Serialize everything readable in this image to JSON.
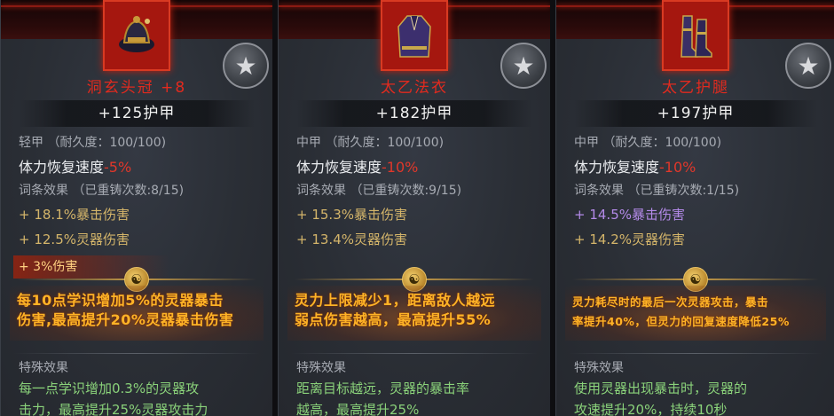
{
  "cards": [
    {
      "name": "洞玄头冠 +8",
      "armor": "+125护甲",
      "type_line": "轻甲 （耐久度：100/100)",
      "stamina_label": "体力恢复速度",
      "stamina_value": "-5%",
      "affix_header": "词条效果 （已重铸次数:8/15)",
      "stat1": "+ 18.1%暴击伤害",
      "stat2": "+ 12.5%灵器伤害",
      "stat3": "+ 3%伤害",
      "legend_line1": "每10点学识增加5%的灵器暴击",
      "legend_line2": "伤害,最高提升20%灵器暴击伤害",
      "special_title": "特殊效果",
      "special_line1": "每一点学识增加0.3%的灵器攻",
      "special_line2": "击力，最高提升25%灵器攻击力"
    },
    {
      "name": "太乙法衣",
      "armor": "+182护甲",
      "type_line": "中甲 （耐久度：100/100)",
      "stamina_label": "体力恢复速度",
      "stamina_value": "-10%",
      "affix_header": "词条效果 （已重铸次数:9/15)",
      "stat1": "+ 15.3%暴击伤害",
      "stat2": "+ 13.4%灵器伤害",
      "legend_line1": "灵力上限减少1，距离敌人越远",
      "legend_line2": "弱点伤害越高，最高提升55%",
      "special_title": "特殊效果",
      "special_line1": "距离目标越远，灵器的暴击率",
      "special_line2": "越高，最高提升25%"
    },
    {
      "name": "太乙护腿",
      "armor": "+197护甲",
      "type_line": "中甲 （耐久度：100/100)",
      "stamina_label": "体力恢复速度",
      "stamina_value": "-10%",
      "affix_header": "词条效果 （已重铸次数:1/15)",
      "stat1": "+ 14.5%暴击伤害",
      "stat2": "+ 14.2%灵器伤害",
      "legend_line1": "灵力耗尽时的最后一次灵器攻击，暴击",
      "legend_line2": "率提升40%，但灵力的回复速度降低25%",
      "special_title": "特殊效果",
      "special_line1": "使用灵器出现暴击时，灵器的",
      "special_line2": "攻速提升20%，持续10秒"
    }
  ],
  "icons": {
    "badge": "star-icon",
    "coin": "yin-yang-icon",
    "item1": "hat-icon",
    "item2": "robe-icon",
    "item3": "boots-icon"
  },
  "colors": {
    "name_red": "#e22a1e",
    "legend_orange": "#ffb326",
    "stat_gold": "#d4b56a",
    "stat_purple": "#b38ae8",
    "special_green": "#8ad27a"
  }
}
